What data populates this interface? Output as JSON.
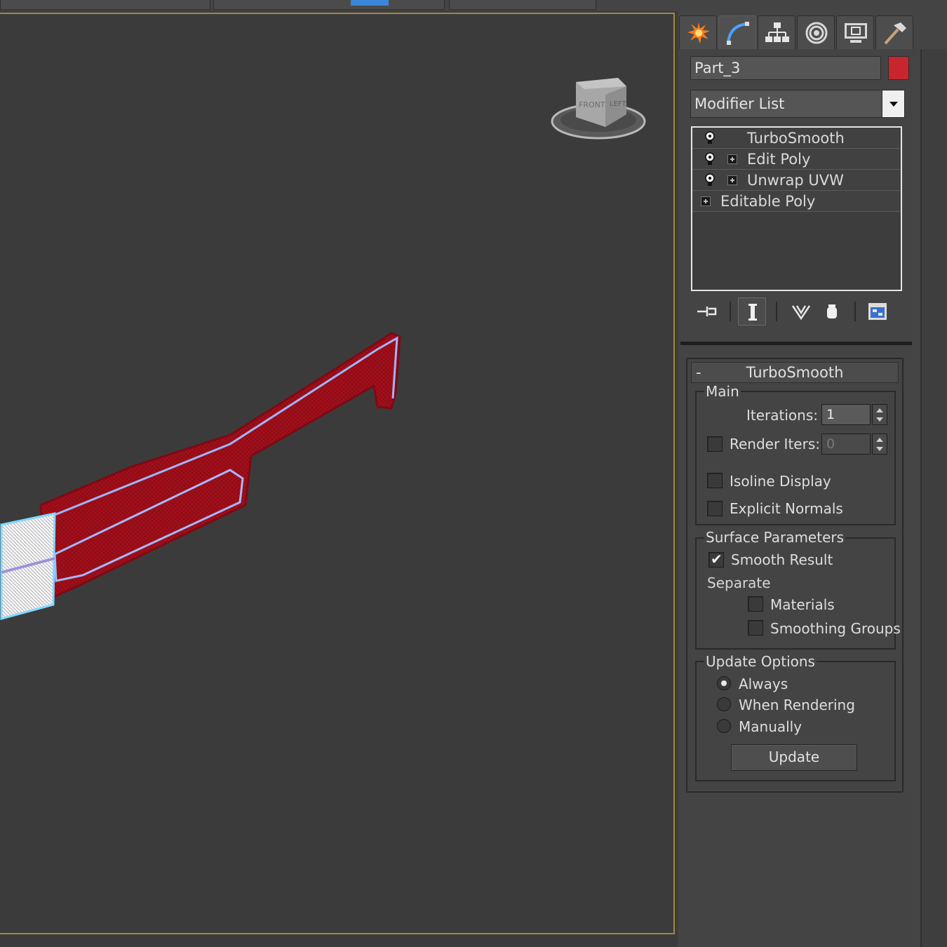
{
  "colors": {
    "viewport_bg": "#3b3b3b",
    "viewport_border": "#a08a44",
    "model_red": "#a8101c",
    "model_edge": "#8fb0ff",
    "object_color": "#c8262e",
    "toolbar_blue": "#3a86d8"
  },
  "command_panel": {
    "tabs": [
      {
        "name": "create",
        "icon": "starburst-icon"
      },
      {
        "name": "modify",
        "icon": "modify-curve-icon"
      },
      {
        "name": "hierarchy",
        "icon": "hierarchy-icon"
      },
      {
        "name": "motion",
        "icon": "motion-target-icon"
      },
      {
        "name": "display",
        "icon": "monitor-icon"
      },
      {
        "name": "utilities",
        "icon": "hammer-icon"
      }
    ],
    "object_name": "Part_3",
    "modifier_list_label": "Modifier List",
    "stack": [
      {
        "label": "TurboSmooth"
      },
      {
        "label": "Edit Poly"
      },
      {
        "label": "Unwrap UVW"
      },
      {
        "label": "Editable Poly"
      }
    ]
  },
  "turbosmooth": {
    "title": "TurboSmooth",
    "collapse_symbol": "-",
    "main": {
      "title": "Main",
      "iterations_label": "Iterations:",
      "iterations_value": "1",
      "render_iters_label": "Render Iters:",
      "render_iters_value": "0",
      "render_iters_checked": false,
      "isoline_label": "Isoline Display",
      "isoline_checked": false,
      "explicit_normals_label": "Explicit Normals",
      "explicit_normals_checked": false
    },
    "surface": {
      "title": "Surface Parameters",
      "smooth_result_label": "Smooth Result",
      "smooth_result_checked": true,
      "separate_label": "Separate",
      "materials_label": "Materials",
      "materials_checked": false,
      "smoothing_groups_label": "Smoothing Groups",
      "smoothing_groups_checked": false
    },
    "update": {
      "title": "Update Options",
      "always_label": "Always",
      "when_rendering_label": "When Rendering",
      "manually_label": "Manually",
      "selected": "Always",
      "update_button": "Update"
    }
  }
}
